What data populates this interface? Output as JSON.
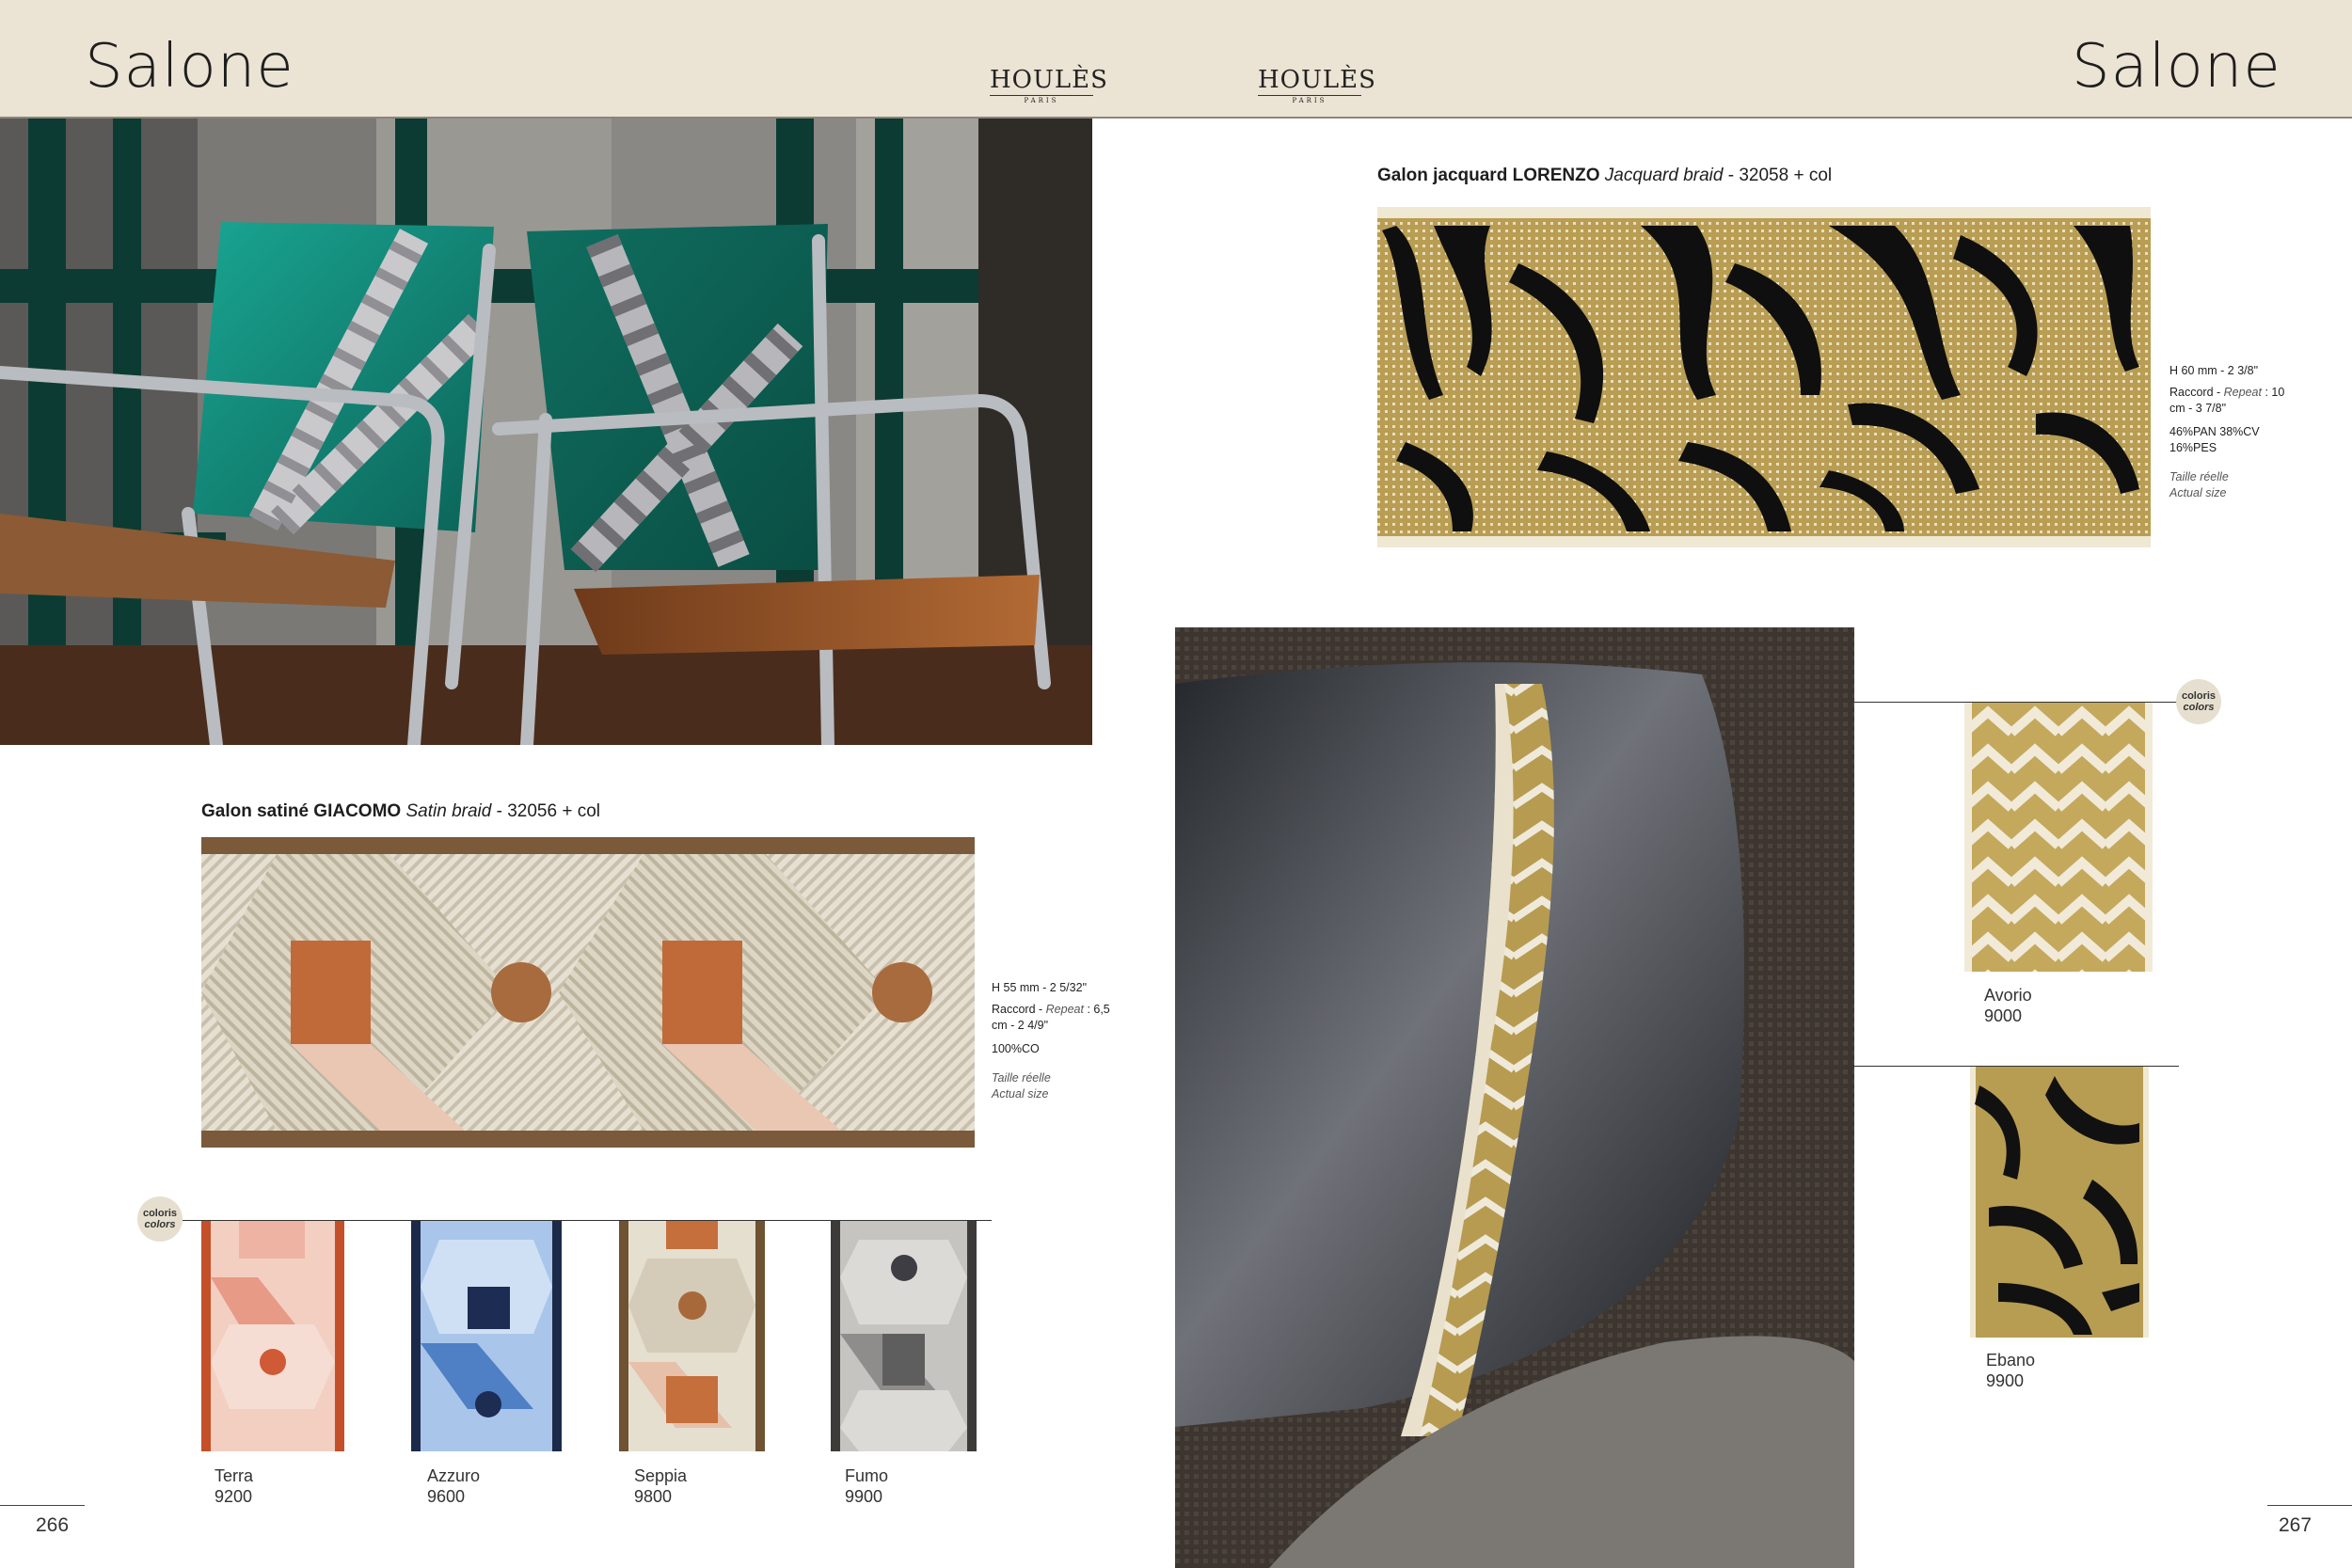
{
  "header": {
    "left_title": "Salone",
    "right_title": "Salone",
    "logo_left": {
      "brand": "HOULÈS",
      "sub": "PARIS"
    },
    "logo_right": {
      "brand": "HOULÈS",
      "sub": "PARIS"
    }
  },
  "left_page": {
    "page_number": "266",
    "product": {
      "type_label": "Galon satiné GIACOMO",
      "english_label": "Satin braid",
      "reference": "- 32056 + col",
      "spec_height": "H 55 mm - 2 5/32\"",
      "spec_repeat_fr": "Raccord - ",
      "spec_repeat_en": "Repeat",
      "spec_repeat_val": " : 6,5 cm - 2 4/9\"",
      "spec_composition": "100%CO",
      "spec_size_fr": "Taille réelle",
      "spec_size_en": "Actual size"
    },
    "colors_badge": {
      "fr": "coloris",
      "en": "colors"
    },
    "swatches": [
      {
        "name": "Terra",
        "code": "9200"
      },
      {
        "name": "Azzuro",
        "code": "9600"
      },
      {
        "name": "Seppia",
        "code": "9800"
      },
      {
        "name": "Fumo",
        "code": "9900"
      }
    ]
  },
  "right_page": {
    "page_number": "267",
    "product": {
      "type_label": "Galon jacquard LORENZO",
      "english_label": "Jacquard braid",
      "reference": "- 32058 + col",
      "spec_height": "H 60 mm - 2 3/8\"",
      "spec_repeat_fr": "Raccord - ",
      "spec_repeat_en": "Repeat",
      "spec_repeat_val": " : 10 cm - 3 7/8\"",
      "spec_composition": "46%PAN 38%CV 16%PES",
      "spec_size_fr": "Taille réelle",
      "spec_size_en": "Actual size"
    },
    "colors_badge": {
      "fr": "coloris",
      "en": "colors"
    },
    "swatches": [
      {
        "name": "Avorio",
        "code": "9000"
      },
      {
        "name": "Ebano",
        "code": "9900"
      }
    ]
  },
  "colors": {
    "header_bg": "#ebe3d3",
    "teal_velvet": "#0f7a6a",
    "gold": "#b59a4a",
    "terra": "#c2703f",
    "azzuro": "#4f7fc4"
  }
}
